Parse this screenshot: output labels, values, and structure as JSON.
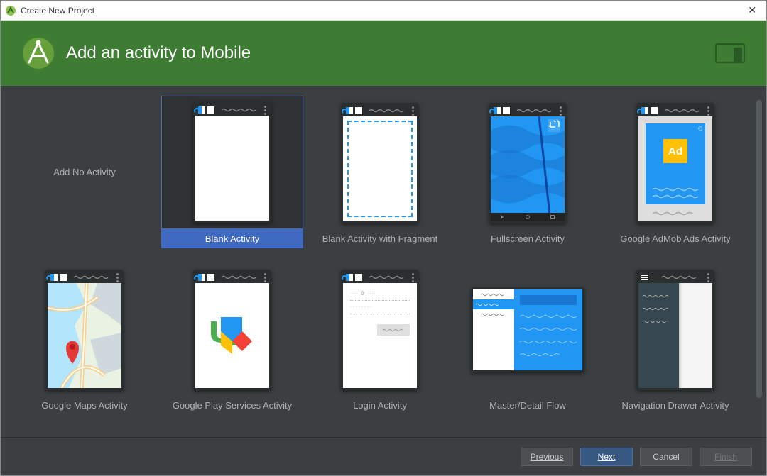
{
  "window": {
    "title": "Create New Project"
  },
  "header": {
    "title": "Add an activity to Mobile"
  },
  "activities": [
    {
      "id": "none",
      "label": "Add No Activity"
    },
    {
      "id": "blank",
      "label": "Blank Activity",
      "selected": true
    },
    {
      "id": "blank_fragment",
      "label": "Blank Activity with Fragment"
    },
    {
      "id": "fullscreen",
      "label": "Fullscreen Activity"
    },
    {
      "id": "admob",
      "label": "Google AdMob Ads Activity"
    },
    {
      "id": "maps",
      "label": "Google Maps Activity"
    },
    {
      "id": "play_services",
      "label": "Google Play Services Activity"
    },
    {
      "id": "login",
      "label": "Login Activity"
    },
    {
      "id": "master_detail",
      "label": "Master/Detail Flow"
    },
    {
      "id": "nav_drawer",
      "label": "Navigation Drawer Activity"
    }
  ],
  "footer": {
    "previous": "Previous",
    "next": "Next",
    "cancel": "Cancel",
    "finish": "Finish"
  }
}
